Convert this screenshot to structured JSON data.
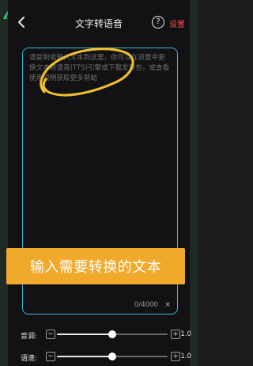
{
  "header": {
    "back_icon": "back-chevron-icon",
    "title": "文字转语音",
    "help_icon": "help-circle-icon",
    "help_glyph": "?",
    "settings_label": "设置"
  },
  "editor": {
    "placeholder": "请复制或输入文本到这里，你可以在设置中更换文本转语音(TTS)引擎或下载发音包，或查看使用说明获取更多帮助",
    "counter": "0/4000",
    "clear_glyph": "×"
  },
  "banner": {
    "text": "输入需要转换的文本"
  },
  "controls": {
    "pitch": {
      "label": "音调:",
      "minus": "−",
      "plus": "+",
      "value": "1.0",
      "level": 0.5
    },
    "speed": {
      "label": "语速:",
      "minus": "−",
      "plus": "+",
      "value": "1.0",
      "level": 0.5
    }
  },
  "colors": {
    "accent_border": "#3bb7d8",
    "settings_red": "#ff4b4b",
    "banner_orange": "#f1a92c",
    "annotation_yellow": "#f2c12e"
  }
}
